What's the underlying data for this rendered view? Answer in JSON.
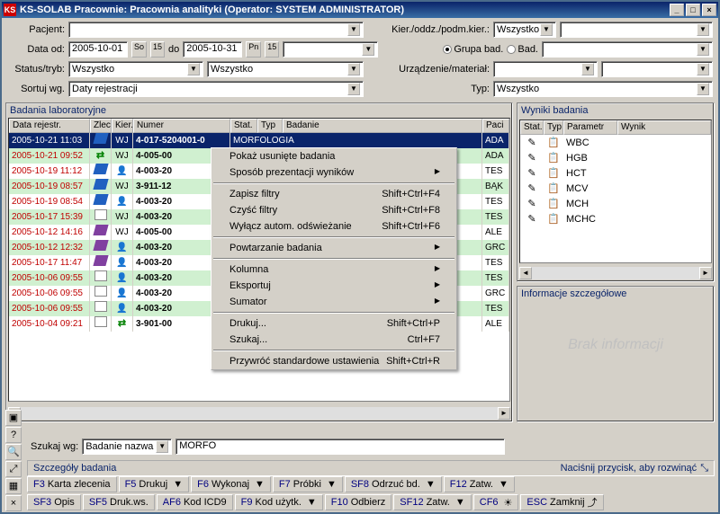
{
  "title": "KS-SOLAB Pracownie:   Pracownia analityki (Operator: SYSTEM ADMINISTRATOR)",
  "labels": {
    "pacjent": "Pacjent:",
    "data_od": "Data od:",
    "do": "do",
    "statustryb": "Status/tryb:",
    "sortuj": "Sortuj wg.",
    "kier": "Kier./oddz./podm.kier.:",
    "grupa_bad": "Grupa bad.",
    "bad": "Bad.",
    "urzadzenie": "Urządzenie/materiał:",
    "typ": "Typ:",
    "szukaj": "Szukaj wg:"
  },
  "filters": {
    "data_od": "2005-10-01",
    "data_do": "2005-10-31",
    "so": "So",
    "pn": "Pn",
    "status1": "Wszystko",
    "status2": "Wszystko",
    "sort": "Daty rejestracji",
    "kier": "Wszystko",
    "typ": "Wszystko",
    "szukaj_wg": "Badanie nazwa",
    "szukaj_val": "MORFO"
  },
  "leftpanel": {
    "title": "Badania laboratoryjne"
  },
  "lhead": {
    "c1": "Data rejestr.",
    "c2": "Zlec.",
    "c3": "Kier.",
    "c4": "Numer",
    "c5a": "Stat.",
    "c5b": "Typ",
    "c5c": "Badanie",
    "c6": "Paci"
  },
  "rows": [
    {
      "dt": "2005-10-21 11:03",
      "i2": "blue",
      "i3": "WJ",
      "num": "4-017-5204001-0",
      "bad": "MORFOLOGIA",
      "pac": "ADA",
      "sel": true
    },
    {
      "dt": "2005-10-21 09:52",
      "i2": "arr",
      "i3": "WJ",
      "num": "4-005-00",
      "pac": "ADA"
    },
    {
      "dt": "2005-10-19 11:12",
      "i2": "blue",
      "i3": "P",
      "num": "4-003-20",
      "pac": "TES"
    },
    {
      "dt": "2005-10-19 08:57",
      "i2": "blue",
      "i3": "WJ",
      "num": "3-911-12",
      "pac": "BĄK"
    },
    {
      "dt": "2005-10-19 08:54",
      "i2": "blue",
      "i3": "P",
      "num": "4-003-20",
      "pac": "TES"
    },
    {
      "dt": "2005-10-17 15:39",
      "i2": "tag",
      "i3": "WJ",
      "num": "4-003-20",
      "pac": "TES"
    },
    {
      "dt": "2005-10-12 14:16",
      "i2": "purple",
      "i3": "WJ",
      "num": "4-005-00",
      "pac": "ALE"
    },
    {
      "dt": "2005-10-12 12:32",
      "i2": "purple",
      "i3": "P",
      "num": "4-003-20",
      "pac": "GRC"
    },
    {
      "dt": "2005-10-17 11:47",
      "i2": "purple",
      "i3": "P",
      "num": "4-003-20",
      "pac": "TES"
    },
    {
      "dt": "2005-10-06 09:55",
      "i2": "tag",
      "i3": "P",
      "num": "4-003-20",
      "pac": "TES"
    },
    {
      "dt": "2005-10-06 09:55",
      "i2": "tag",
      "i3": "P",
      "num": "4-003-20",
      "pac": "GRC"
    },
    {
      "dt": "2005-10-06 09:55",
      "i2": "tag",
      "i3": "P",
      "num": "4-003-20",
      "pac": "TES"
    },
    {
      "dt": "2005-10-04 09:21",
      "i2": "tag",
      "i3": "arr",
      "num": "3-901-00",
      "pac": "ALE"
    }
  ],
  "ctx": [
    {
      "t": "Pokaż usunięte badania"
    },
    {
      "t": "Sposób prezentacji wyników",
      "sub": true
    },
    {
      "sep": true
    },
    {
      "t": "Zapisz filtry",
      "sc": "Shift+Ctrl+F4"
    },
    {
      "t": "Czyść filtry",
      "sc": "Shift+Ctrl+F8"
    },
    {
      "t": "Wyłącz autom. odświeżanie",
      "sc": "Shift+Ctrl+F6"
    },
    {
      "sep": true
    },
    {
      "t": "Powtarzanie badania",
      "sub": true
    },
    {
      "sep": true
    },
    {
      "t": "Kolumna",
      "sub": true
    },
    {
      "t": "Eksportuj",
      "sub": true
    },
    {
      "t": "Sumator",
      "sub": true
    },
    {
      "sep": true
    },
    {
      "t": "Drukuj...",
      "sc": "Shift+Ctrl+P"
    },
    {
      "t": "Szukaj...",
      "sc": "Ctrl+F7"
    },
    {
      "sep": true
    },
    {
      "t": "Przywróć standardowe ustawienia",
      "sc": "Shift+Ctrl+R"
    }
  ],
  "rpanel1": {
    "title": "Wyniki badania"
  },
  "rhead": {
    "c1": "Stat.",
    "c2": "Typ",
    "c3": "Parametr",
    "c4": "Wynik"
  },
  "rrows": [
    {
      "p": "WBC"
    },
    {
      "p": "HGB"
    },
    {
      "p": "HCT"
    },
    {
      "p": "MCV"
    },
    {
      "p": "MCH"
    },
    {
      "p": "MCHC"
    }
  ],
  "rpanel2": {
    "title": "Informacje szczegółowe",
    "noinfo": "Brak informacji"
  },
  "detail": {
    "l": "Szczegóły badania",
    "r": "Naciśnij przycisk, aby rozwinąć"
  },
  "fbtns1": [
    {
      "k": "F3",
      "t": "Karta zlecenia"
    },
    {
      "k": "F5",
      "t": "Drukuj",
      "d": true
    },
    {
      "k": "F6",
      "t": "Wykonaj",
      "d": true
    },
    {
      "k": "F7",
      "t": "Próbki",
      "d": true
    },
    {
      "k": "SF8",
      "t": "Odrzuć bd.",
      "d": true
    },
    {
      "k": "F12",
      "t": "Zatw.",
      "d": true
    }
  ],
  "fbtns2": [
    {
      "k": "SF3",
      "t": "Opis"
    },
    {
      "k": "SF5",
      "t": "Druk.ws."
    },
    {
      "k": "AF6",
      "t": "Kod ICD9"
    },
    {
      "k": "F9",
      "t": "Kod użytk.",
      "d": true
    },
    {
      "k": "F10",
      "t": "Odbierz"
    },
    {
      "k": "SF12",
      "t": "Zatw.",
      "d": true
    },
    {
      "k": "CF6",
      "t": "",
      "i": "☀"
    },
    {
      "k": "ESC",
      "t": "Zamknij",
      "i": "⤴"
    }
  ]
}
